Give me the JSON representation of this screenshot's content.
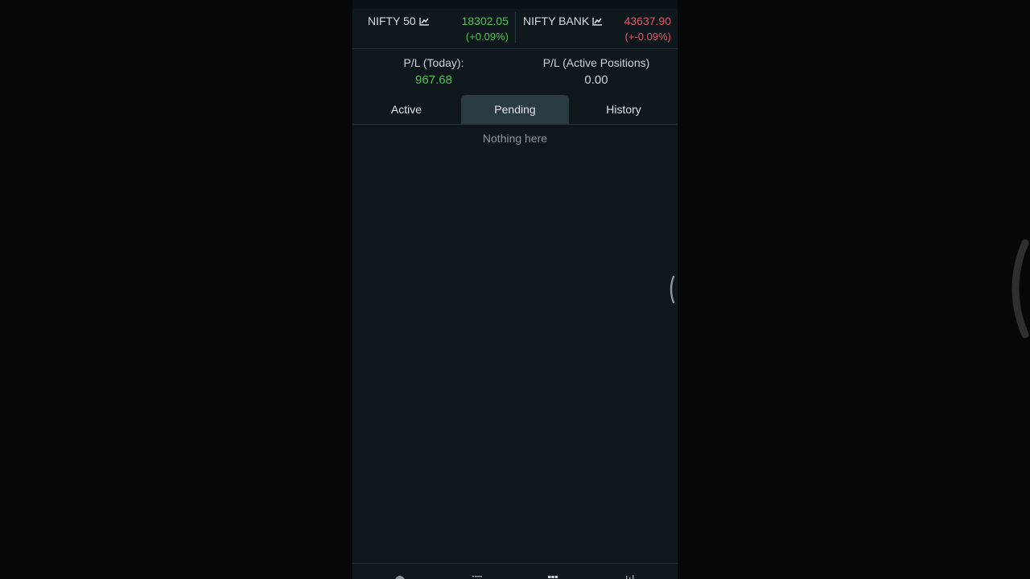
{
  "tickers": [
    {
      "name": "NIFTY 50",
      "icon": "line-chart-icon",
      "value": "18302.05",
      "change": "(+0.09%)",
      "trend": "up"
    },
    {
      "name": "NIFTY BANK",
      "icon": "line-chart-icon",
      "value": "43637.90",
      "change": "(+-0.09%)",
      "trend": "down"
    }
  ],
  "pl": {
    "today_label": "P/L (Today):",
    "today_value": "967.68",
    "active_label": "P/L (Active Positions)",
    "active_value": "0.00"
  },
  "tabs": [
    {
      "label": "Active",
      "selected": false
    },
    {
      "label": "Pending",
      "selected": true
    },
    {
      "label": "History",
      "selected": false
    }
  ],
  "empty_state": "Nothing here",
  "colors": {
    "positive": "#4cc34f",
    "negative": "#e0566b",
    "background": "#0d171c",
    "tab_selected": "#2b3b42"
  },
  "bottom_nav": [
    {
      "icon": "pie-chart-icon"
    },
    {
      "icon": "list-icon"
    },
    {
      "icon": "grid-icon"
    },
    {
      "icon": "bar-chart-icon"
    }
  ]
}
